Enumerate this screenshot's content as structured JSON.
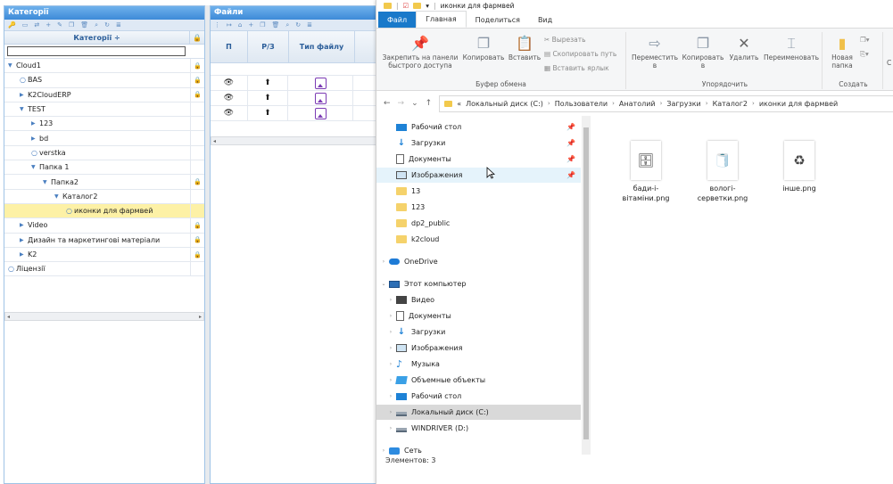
{
  "categories_panel": {
    "title": "Категорії",
    "toolbar_icons": [
      "key-icon",
      "folder-icon",
      "move-icon",
      "plus-icon",
      "edit-icon",
      "copy-icon",
      "trash-icon",
      "search-icon",
      "refresh-icon",
      "list-icon"
    ],
    "column_header": "Категорії ÷",
    "lock_header": "🔒",
    "filter_value": "",
    "tree": [
      {
        "label": "Cloud1",
        "level": 0,
        "node": "expanded",
        "locked": true
      },
      {
        "label": "BAS",
        "level": 1,
        "node": "leaf",
        "locked": true
      },
      {
        "label": "K2CloudERP",
        "level": 1,
        "node": "collapsed",
        "locked": true
      },
      {
        "label": "TEST",
        "level": 1,
        "node": "expanded",
        "locked": false
      },
      {
        "label": "123",
        "level": 2,
        "node": "collapsed",
        "locked": false
      },
      {
        "label": "bd",
        "level": 2,
        "node": "collapsed",
        "locked": false
      },
      {
        "label": "verstka",
        "level": 2,
        "node": "leaf",
        "locked": false
      },
      {
        "label": "Папка 1",
        "level": 2,
        "node": "expanded",
        "locked": false
      },
      {
        "label": "Папка2",
        "level": 3,
        "node": "expanded",
        "locked": true
      },
      {
        "label": "Каталог2",
        "level": 4,
        "node": "expanded",
        "locked": false
      },
      {
        "label": "иконки для фармвей",
        "level": 5,
        "node": "leaf",
        "locked": false,
        "selected": true
      },
      {
        "label": "Video",
        "level": 1,
        "node": "collapsed",
        "locked": true
      },
      {
        "label": "Дизайн та маркетингові матеріали",
        "level": 1,
        "node": "collapsed",
        "locked": true
      },
      {
        "label": "K2",
        "level": 1,
        "node": "collapsed",
        "locked": true
      },
      {
        "label": "Ліцензії",
        "level": 0,
        "node": "leaf",
        "locked": false
      }
    ]
  },
  "files_panel": {
    "title": "Файли",
    "columns": [
      "П",
      "Р/З",
      "Тип файлу"
    ],
    "rows": [
      {
        "view": "👁",
        "upload": "⬆",
        "type": "image-icon"
      },
      {
        "view": "👁",
        "upload": "⬆",
        "type": "image-icon"
      },
      {
        "view": "👁",
        "upload": "⬆",
        "type": "image-icon"
      }
    ]
  },
  "explorer": {
    "title": "иконки для фармвей",
    "tabs": [
      "Файл",
      "Главная",
      "Поделиться",
      "Вид"
    ],
    "ribbon": {
      "pin_label": "Закрепить на панели быстрого доступа",
      "copy_label": "Копировать",
      "paste_label": "Вставить",
      "cut_label": "Вырезать",
      "copy_path_label": "Скопировать путь",
      "paste_shortcut_label": "Вставить ярлык",
      "clipboard_group": "Буфер обмена",
      "move_to_label": "Переместить в",
      "copy_to_label": "Копировать в",
      "delete_label": "Удалить",
      "rename_label": "Переименовать",
      "organize_group": "Упорядочить",
      "new_folder_label": "Новая папка",
      "create_group": "Создать",
      "cut_off_label": "С"
    },
    "address": [
      "«",
      "Локальный диск (C:)",
      "Пользователи",
      "Анатолий",
      "Загрузки",
      "Каталог2",
      "иконки для фармвей"
    ],
    "nav": [
      {
        "label": "Рабочий стол",
        "icon": "desktop-icon",
        "pinned": true,
        "indent": 1
      },
      {
        "label": "Загрузки",
        "icon": "downloads-icon",
        "pinned": true,
        "indent": 1
      },
      {
        "label": "Документы",
        "icon": "documents-icon",
        "pinned": true,
        "indent": 1
      },
      {
        "label": "Изображения",
        "icon": "pictures-icon",
        "pinned": true,
        "indent": 1,
        "hover": true
      },
      {
        "label": "13",
        "icon": "folder-icon",
        "indent": 1
      },
      {
        "label": "123",
        "icon": "folder-icon",
        "indent": 1
      },
      {
        "label": "dp2_public",
        "icon": "folder-icon",
        "indent": 1
      },
      {
        "label": "k2cloud",
        "icon": "folder-icon",
        "indent": 1
      },
      {
        "label": "OneDrive",
        "icon": "onedrive-icon",
        "indent": 0,
        "expander": "›",
        "gap": true
      },
      {
        "label": "Этот компьютер",
        "icon": "computer-icon",
        "indent": 0,
        "expander": "⌄",
        "gap": true
      },
      {
        "label": "Видео",
        "icon": "video-icon",
        "indent": 1,
        "expander": "›"
      },
      {
        "label": "Документы",
        "icon": "documents-icon",
        "indent": 1,
        "expander": "›"
      },
      {
        "label": "Загрузки",
        "icon": "downloads-icon",
        "indent": 1,
        "expander": "›"
      },
      {
        "label": "Изображения",
        "icon": "pictures-icon",
        "indent": 1,
        "expander": "›"
      },
      {
        "label": "Музыка",
        "icon": "music-icon",
        "indent": 1,
        "expander": "›"
      },
      {
        "label": "Объемные объекты",
        "icon": "3d-objects-icon",
        "indent": 1,
        "expander": "›"
      },
      {
        "label": "Рабочий стол",
        "icon": "desktop-icon",
        "indent": 1,
        "expander": "›"
      },
      {
        "label": "Локальный диск (C:)",
        "icon": "disk-icon",
        "indent": 1,
        "expander": "›",
        "selected": true
      },
      {
        "label": "WINDRIVER (D:)",
        "icon": "disk-icon",
        "indent": 1,
        "expander": "›"
      },
      {
        "label": "Сеть",
        "icon": "network-icon",
        "indent": 0,
        "expander": "›",
        "gap": true
      }
    ],
    "files": [
      {
        "name": "бади-і-вітаміни.png",
        "glyph": "🗄"
      },
      {
        "name": "вологі-серветки.png",
        "glyph": "🧻"
      },
      {
        "name": "інше.png",
        "glyph": "♻"
      }
    ],
    "status": "Элементов: 3"
  }
}
